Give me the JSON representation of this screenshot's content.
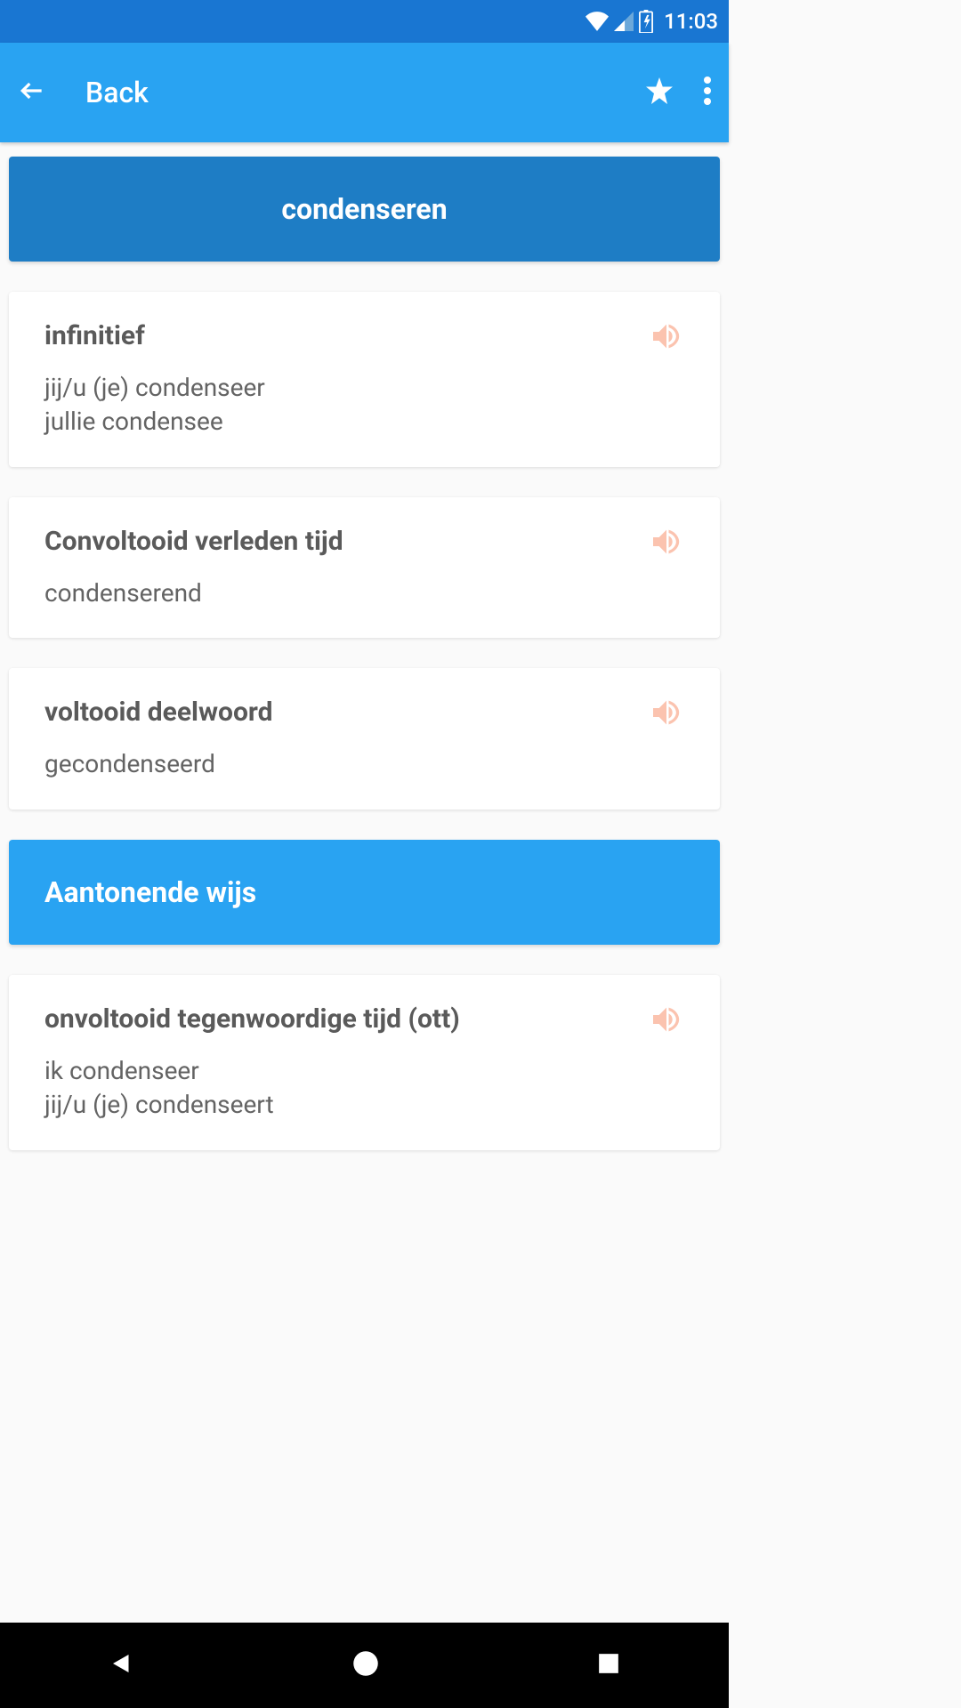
{
  "status": {
    "time": "11:03"
  },
  "toolbar": {
    "title": "Back"
  },
  "word_header": "condenseren",
  "cards": [
    {
      "title": "infinitief",
      "body": "jij/u (je) condenseer\njullie condensee"
    },
    {
      "title": "Convoltooid verleden tijd",
      "body": "condenserend"
    },
    {
      "title": "voltooid deelwoord",
      "body": "gecondenseerd"
    }
  ],
  "section_header": "Aantonende wijs",
  "card_last": {
    "title": "onvoltooid tegenwoordige tijd (ott)",
    "body": "ik condenseer\njij/u (je) condenseert"
  }
}
